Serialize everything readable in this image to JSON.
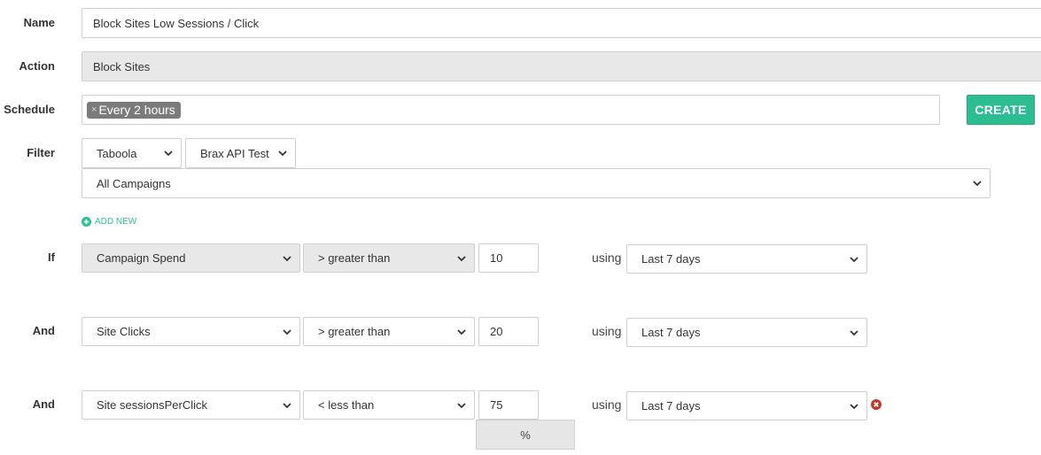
{
  "labels": {
    "name": "Name",
    "action": "Action",
    "schedule": "Schedule",
    "filter": "Filter"
  },
  "name_value": "Block Sites Low Sessions / Click",
  "action_value": "Block Sites",
  "schedule": {
    "tags": [
      "Every 2 hours"
    ],
    "tag_remove_glyph": "×",
    "create_label": "CREATE"
  },
  "filter": {
    "network": "Taboola",
    "account": "Brax API Test",
    "campaigns": "All Campaigns",
    "add_new_label": "ADD NEW"
  },
  "using_label": "using",
  "conditions": [
    {
      "connector": "If",
      "metric": "Campaign Spend",
      "operator": "> greater than",
      "value": "10",
      "period": "Last 7 days"
    },
    {
      "connector": "And",
      "metric": "Site Clicks",
      "operator": "> greater than",
      "value": "20",
      "period": "Last 7 days"
    },
    {
      "connector": "And",
      "metric": "Site sessionsPerClick",
      "operator": "< less than",
      "value": "75",
      "period": "Last 7 days",
      "unit": "%"
    }
  ],
  "colors": {
    "accent": "#2dbd93",
    "remove": "#c0392b"
  },
  "icons": {
    "select_arrow": "chevron-down-icon",
    "add": "plus-circle-icon",
    "remove": "remove-circle-icon"
  }
}
